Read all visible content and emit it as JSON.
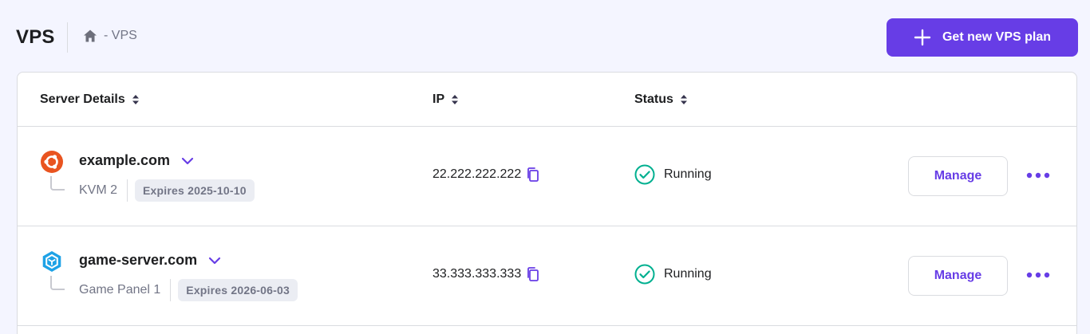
{
  "header": {
    "title": "VPS",
    "breadcrumb": {
      "home_icon": "home-icon",
      "separator_text": "- VPS"
    },
    "cta_label": "Get new VPS plan"
  },
  "table": {
    "columns": [
      {
        "label": "Server Details",
        "sortable": true
      },
      {
        "label": "IP",
        "sortable": true
      },
      {
        "label": "Status",
        "sortable": true
      }
    ],
    "rows": [
      {
        "os_icon": "ubuntu-icon",
        "domain": "example.com",
        "plan": "KVM 2",
        "expires": "Expires 2025-10-10",
        "ip": "22.222.222.222",
        "status": "Running",
        "manage_label": "Manage"
      },
      {
        "os_icon": "game-panel-icon",
        "domain": "game-server.com",
        "plan": "Game Panel 1",
        "expires": "Expires 2026-06-03",
        "ip": "33.333.333.333",
        "status": "Running",
        "manage_label": "Manage"
      }
    ]
  },
  "colors": {
    "accent": "#673de6",
    "background": "#f4f5ff",
    "success": "#00b090",
    "ubuntu": "#e95420",
    "game_panel": "#1ea2e6",
    "muted_text": "#727586",
    "border": "#dadce0"
  }
}
